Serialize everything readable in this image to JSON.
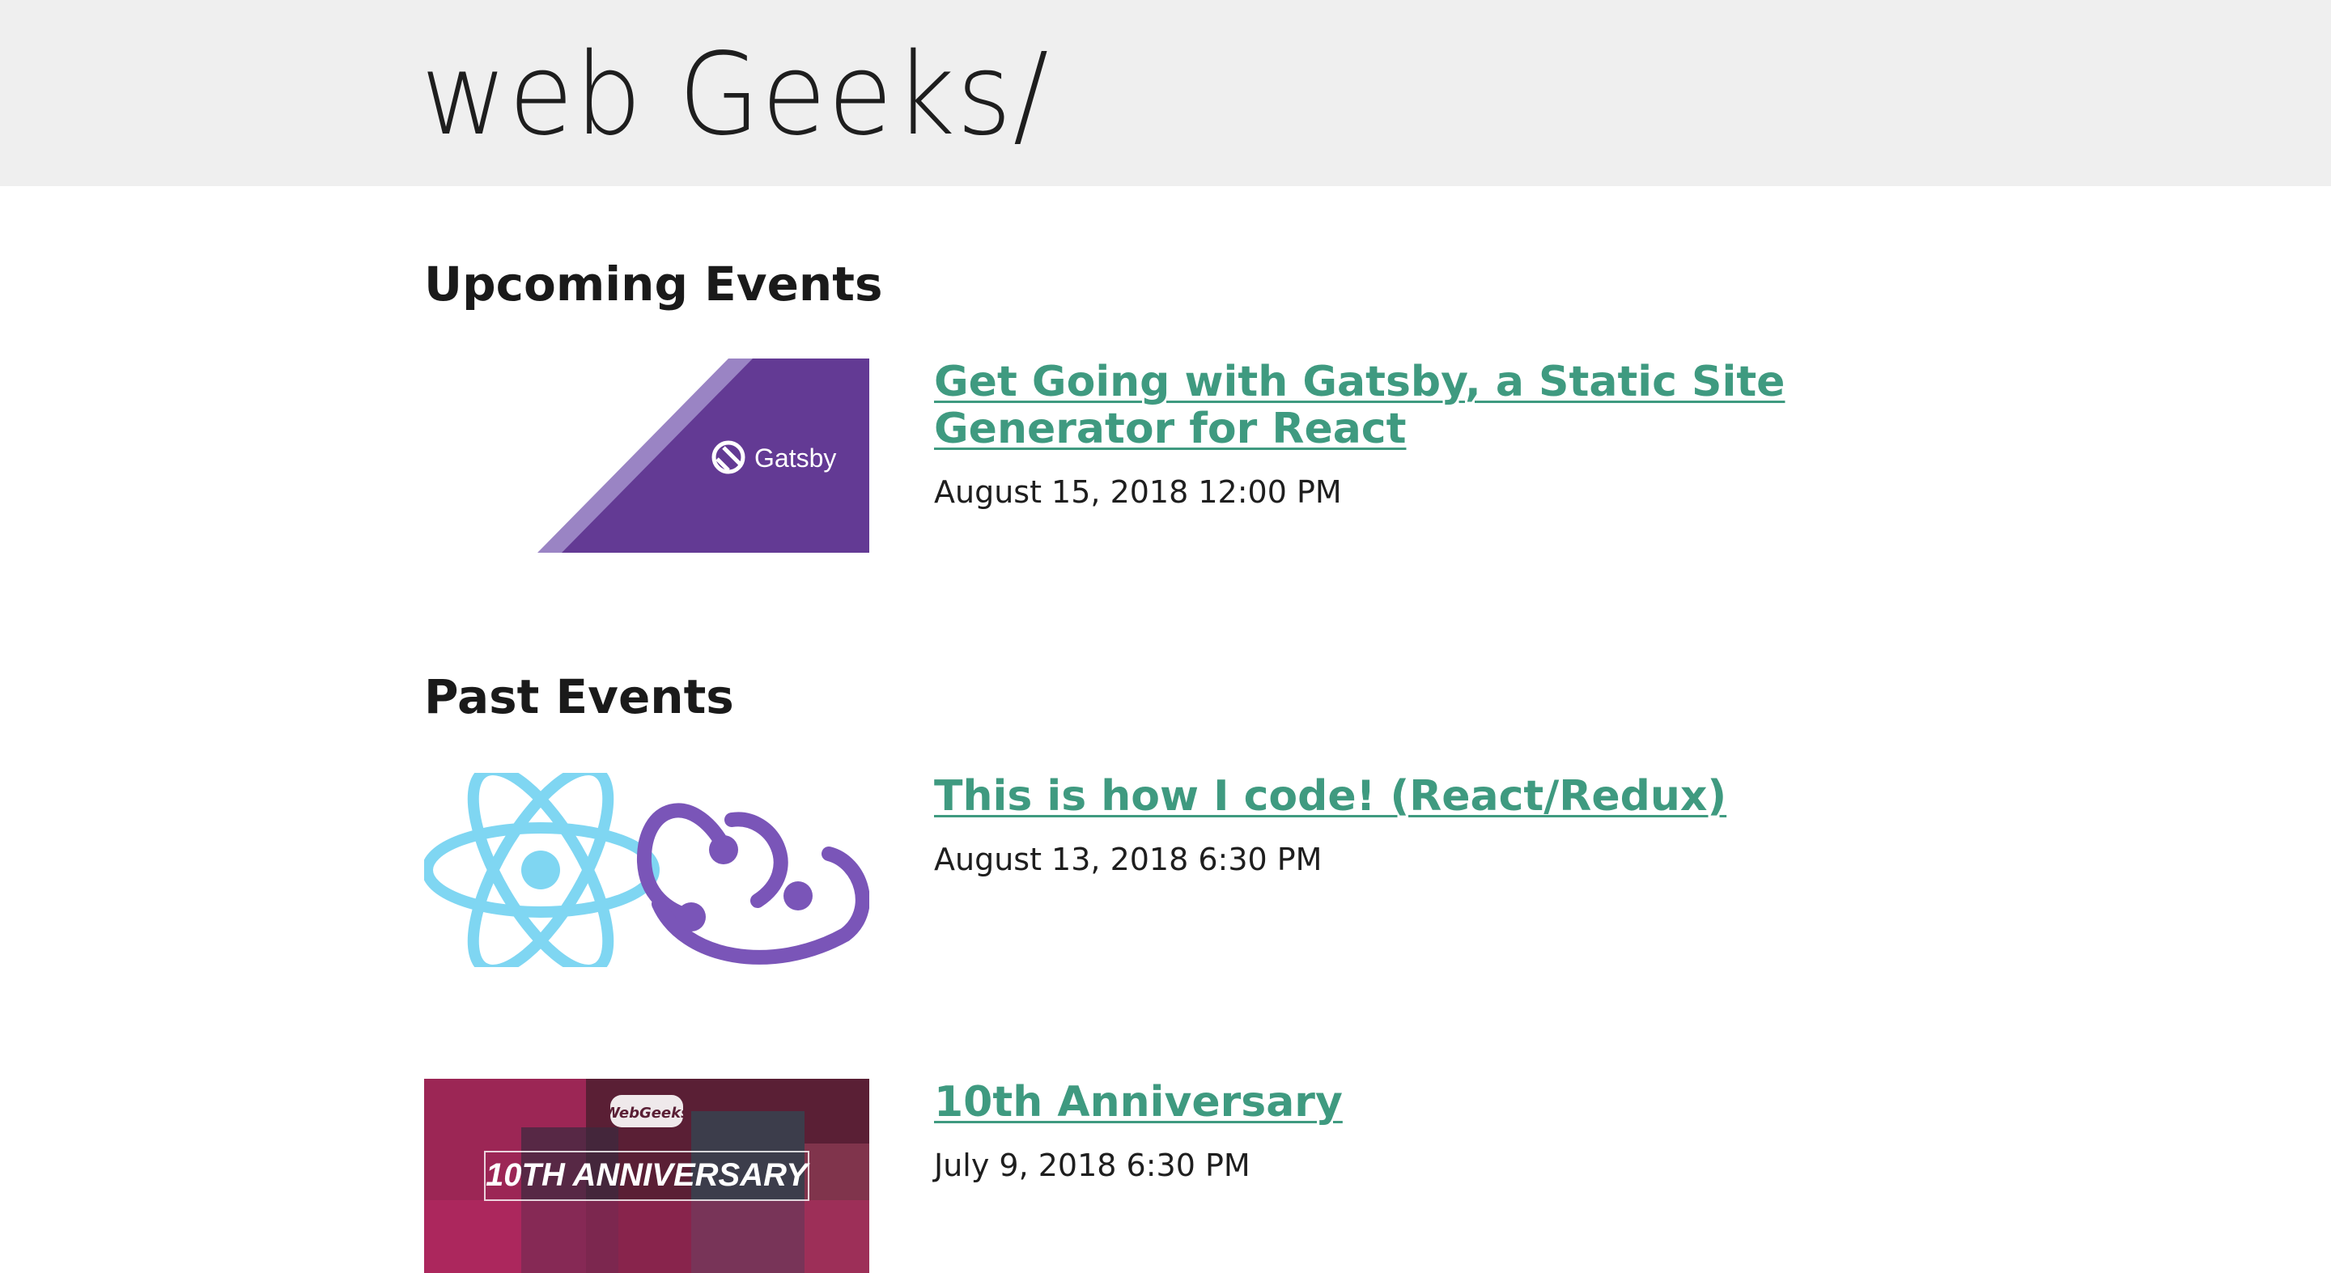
{
  "site": {
    "logo_text": "web Geeks/"
  },
  "sections": {
    "upcoming_title": "Upcoming Events",
    "past_title": "Past Events"
  },
  "events": {
    "upcoming": [
      {
        "title": "Get Going with Gatsby, a Static Site Generator for React",
        "date": "August 15, 2018 12:00 PM",
        "image_label": "Gatsby"
      }
    ],
    "past": [
      {
        "title": "This is how I code! (React/Redux)",
        "date": "August 13, 2018 6:30 PM"
      },
      {
        "title": "10th Anniversary",
        "date": "July 9, 2018 6:30 PM",
        "image_label": "10TH ANNIVERSARY",
        "image_logo": "WebGeeks"
      }
    ]
  },
  "colors": {
    "header_bg": "#efefef",
    "link": "#3f9a80",
    "gatsby_purple": "#633a94",
    "react_blue": "#7fd6f2",
    "redux_purple": "#7a55b8",
    "anniversary_magenta": "#a8285a"
  }
}
